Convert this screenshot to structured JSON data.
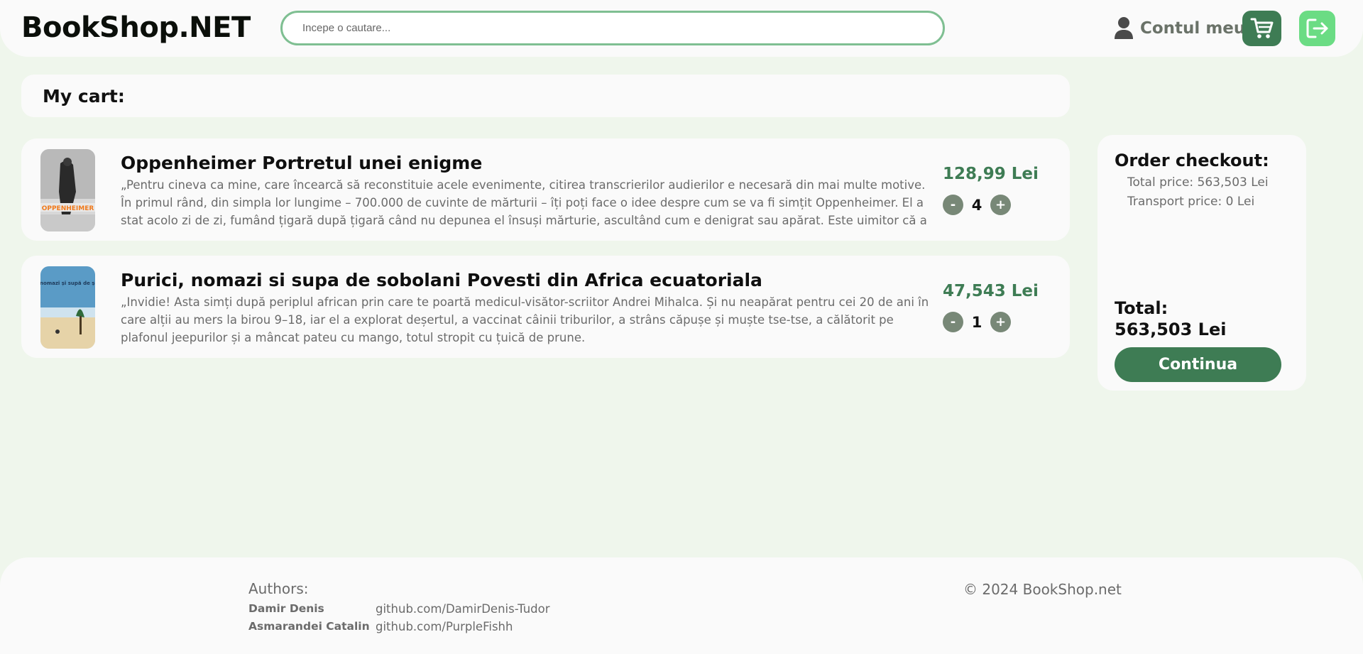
{
  "header": {
    "logo": "BookShop.NET",
    "search_placeholder": "Incepe o cautare...",
    "account_label": "Contul meu"
  },
  "cart": {
    "title": "My cart:",
    "items": [
      {
        "title": "Oppenheimer Portretul unei enigme",
        "description": "„Pentru cineva ca mine, care încearcă să reconstituie acele evenimente, citirea transcrierilor audierilor e necesară din mai multe motive. În primul rând, din simpla lor lungime – 700.000 de cuvinte de mărturii – îți poți face o idee despre cum se va fi simțit Oppenheimer. El a stat acolo zi de zi, fumând țigară după țigară când nu depunea el însuși mărturie, ascultând cum e denigrat sau apărat. Este uimitor că a rezistat",
        "price": "128,99 Lei",
        "quantity": "4",
        "cover_text": "OPPENHEIMER"
      },
      {
        "title": "Purici, nomazi si supa de sobolani Povesti din Africa ecuatoriala",
        "description": "„Invidie! Asta simți după periplul african prin care te poartă medicul-visător-scriitor Andrei Mihalca. Și nu neapărat pentru cei 20 de ani în care alții au mers la birou 9–18, iar el a explorat deșertul, a vaccinat câinii triburilor, a strâns căpușe și muște tse-tse, a călătorit pe plafonul jeepurilor și a mâncat pateu cu mango, totul stropit cu țuică de prune.",
        "price": "47,543 Lei",
        "quantity": "1",
        "cover_text": "Purici, nomazi și supă de șobolani"
      }
    ],
    "minus_label": "-",
    "plus_label": "+"
  },
  "checkout": {
    "title": "Order checkout:",
    "total_price": "Total price: 563,503 Lei",
    "transport_price": "Transport price: 0 Lei",
    "total_label": "Total:",
    "total_value": "563,503 Lei",
    "continue_label": "Continua"
  },
  "footer": {
    "authors_label": "Authors:",
    "authors": [
      {
        "name": "Damir Denis",
        "link": "github.com/DamirDenis-Tudor"
      },
      {
        "name": "Asmarandei Catalin",
        "link": "github.com/PurpleFishh"
      }
    ],
    "copyright": "© 2024 BookShop.net"
  },
  "colors": {
    "background": "#eff6ec",
    "panel": "#fafafa",
    "accent_dark": "#3e7c54",
    "accent_light": "#6bdc84",
    "search_border": "#7fbf92",
    "qty_button": "#788877"
  },
  "icons": {
    "account": "user-icon",
    "cart": "shopping-cart-icon",
    "logout": "logout-icon"
  }
}
